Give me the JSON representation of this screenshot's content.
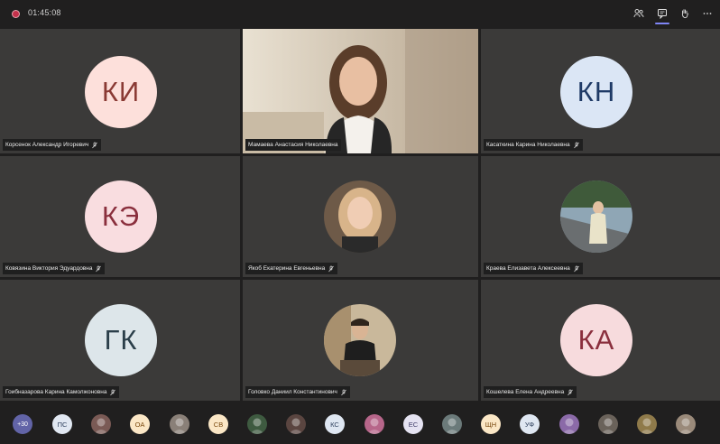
{
  "call": {
    "timer": "01:45:08",
    "recording_color": "#c4314b",
    "toolbar": [
      {
        "name": "participants-icon",
        "icon": "people"
      },
      {
        "name": "chat-icon",
        "icon": "chat"
      },
      {
        "name": "raise-hand-icon",
        "icon": "hand"
      },
      {
        "name": "more-options-icon",
        "icon": "ellipsis"
      }
    ]
  },
  "tiles": [
    {
      "name": "Корсенок Александр Игоревич",
      "initials": "КИ",
      "avatar_bg": "#fde0db",
      "avatar_fg": "#8a3a34",
      "type": "initials"
    },
    {
      "name": "Мамаева Анастасия Николаевна",
      "type": "video"
    },
    {
      "name": "Касаткина Карина Николаевна",
      "initials": "КН",
      "avatar_bg": "#dbe6f5",
      "avatar_fg": "#1f3a66",
      "type": "initials"
    },
    {
      "name": "Ковязина Виктория Эдуардовна",
      "initials": "КЭ",
      "avatar_bg": "#f9dde0",
      "avatar_fg": "#8a2f3d",
      "type": "initials"
    },
    {
      "name": "Якоб Екатерина Евгеньевна",
      "type": "photo"
    },
    {
      "name": "Краева Елизавета Алексеевна",
      "type": "photo"
    },
    {
      "name": "Гоибназарова Карина Камолжоновна",
      "initials": "ГК",
      "avatar_bg": "#dde6ea",
      "avatar_fg": "#2b3f4a",
      "type": "initials"
    },
    {
      "name": "Головко Даниил Константинович",
      "type": "photo"
    },
    {
      "name": "Кошелева Елена Андреевна",
      "initials": "КА",
      "avatar_bg": "#f7dbdd",
      "avatar_fg": "#8a2f3d",
      "type": "initials"
    }
  ],
  "overflow": {
    "count": "+30",
    "avatars": [
      {
        "label": "ПС",
        "bg": "#e1e8f2",
        "fg": "#2d3f5c"
      },
      {
        "label": "",
        "bg": "#7a5a55",
        "fg": "#ffffff",
        "icon": "photo"
      },
      {
        "label": "ОА",
        "bg": "#fbe7c6",
        "fg": "#7a4a10"
      },
      {
        "label": "",
        "bg": "#8a8078",
        "fg": "#ffffff",
        "icon": "photo"
      },
      {
        "label": "СВ",
        "bg": "#fbe7c6",
        "fg": "#7a4a10"
      },
      {
        "label": "",
        "bg": "#3e5a40",
        "fg": "#ffffff",
        "icon": "photo"
      },
      {
        "label": "",
        "bg": "#5a4540",
        "fg": "#ffffff",
        "icon": "photo"
      },
      {
        "label": "КС",
        "bg": "#dfe7f2",
        "fg": "#2d3f5c"
      },
      {
        "label": "",
        "bg": "#b7668a",
        "fg": "#ffffff",
        "icon": "photo"
      },
      {
        "label": "ЕС",
        "bg": "#e5e3f2",
        "fg": "#3d3a66"
      },
      {
        "label": "",
        "bg": "#6b7a7a",
        "fg": "#ffffff",
        "icon": "photo"
      },
      {
        "label": "ЩН",
        "bg": "#fbe7c6",
        "fg": "#7a4a10"
      },
      {
        "label": "УФ",
        "bg": "#dfe7f2",
        "fg": "#2d3f5c"
      },
      {
        "label": "",
        "bg": "#8b6aa8",
        "fg": "#ffffff",
        "icon": "photo"
      },
      {
        "label": "",
        "bg": "#6a625a",
        "fg": "#ffffff",
        "icon": "photo"
      },
      {
        "label": "",
        "bg": "#8f7a4a",
        "fg": "#ffffff",
        "icon": "photo"
      },
      {
        "label": "",
        "bg": "#9a8a7a",
        "fg": "#ffffff",
        "icon": "photo"
      }
    ]
  }
}
